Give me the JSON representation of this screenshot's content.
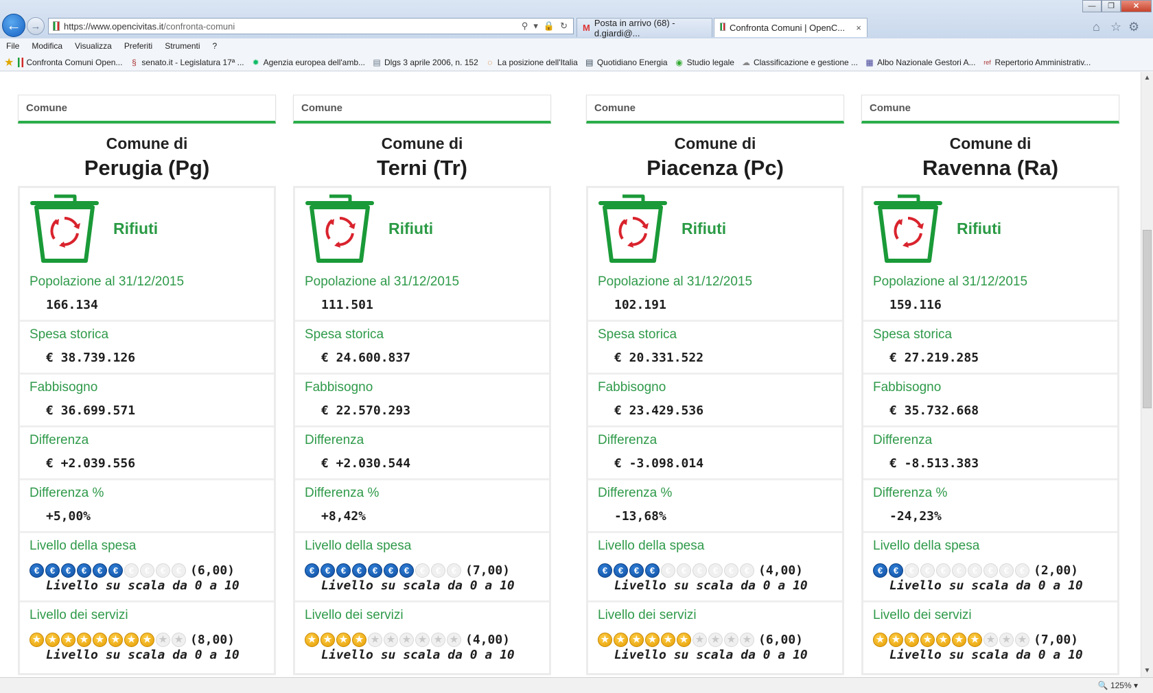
{
  "browser": {
    "url_host": "https://www.opencivitas.it",
    "url_path": "/confronta-comuni",
    "tabs": [
      {
        "label": "Posta in arrivo (68) - d.giardi@..."
      },
      {
        "label": "Confronta Comuni | OpenC...",
        "close": "×"
      }
    ],
    "menu": [
      "File",
      "Modifica",
      "Visualizza",
      "Preferiti",
      "Strumenti",
      "?"
    ],
    "favorites": [
      "Confronta Comuni  Open...",
      "senato.it - Legislatura 17ª ...",
      "Agenzia europea dell'amb...",
      "Dlgs 3 aprile 2006, n. 152",
      "La posizione dell'Italia",
      "Quotidiano Energia",
      "Studio legale",
      "Classificazione e gestione ...",
      "Albo Nazionale Gestori A...",
      "Repertorio Amministrativ..."
    ],
    "zoom": "125%"
  },
  "labels": {
    "header": "Comune",
    "comune_di": "Comune di",
    "sector": "Rifiuti",
    "popolazione": "Popolazione al 31/12/2015",
    "spesa_storica": "Spesa storica",
    "fabbisogno": "Fabbisogno",
    "differenza": "Differenza",
    "differenza_pct": "Differenza %",
    "livello_spesa": "Livello della spesa",
    "livello_servizi": "Livello dei servizi",
    "scala": "Livello su scala da 0 a 10"
  },
  "comuni": [
    {
      "name": "Perugia (Pg)",
      "popolazione": "166.134",
      "spesa_storica": "€ 38.739.126",
      "fabbisogno": "€ 36.699.571",
      "differenza": "€ +2.039.556",
      "differenza_pct": "+5,00%",
      "livello_spesa": 6,
      "livello_spesa_label": "(6,00)",
      "livello_servizi": 8,
      "livello_servizi_label": "(8,00)"
    },
    {
      "name": "Terni (Tr)",
      "popolazione": "111.501",
      "spesa_storica": "€ 24.600.837",
      "fabbisogno": "€ 22.570.293",
      "differenza": "€ +2.030.544",
      "differenza_pct": "+8,42%",
      "livello_spesa": 7,
      "livello_spesa_label": "(7,00)",
      "livello_servizi": 4,
      "livello_servizi_label": "(4,00)"
    },
    {
      "name": "Piacenza (Pc)",
      "popolazione": "102.191",
      "spesa_storica": "€ 20.331.522",
      "fabbisogno": "€ 23.429.536",
      "differenza": "€ -3.098.014",
      "differenza_pct": "-13,68%",
      "livello_spesa": 4,
      "livello_spesa_label": "(4,00)",
      "livello_servizi": 6,
      "livello_servizi_label": "(6,00)"
    },
    {
      "name": "Ravenna (Ra)",
      "popolazione": "159.116",
      "spesa_storica": "€ 27.219.285",
      "fabbisogno": "€ 35.732.668",
      "differenza": "€ -8.513.383",
      "differenza_pct": "-24,23%",
      "livello_spesa": 2,
      "livello_spesa_label": "(2,00)",
      "livello_servizi": 7,
      "livello_servizi_label": "(7,00)"
    }
  ],
  "colors": {
    "accent_green": "#2bad4a",
    "label_green": "#2f9a4a",
    "euro_blue": "#0f4e9f",
    "star_orange": "#e49c00",
    "recycle_red": "#d9232d"
  },
  "icons": {
    "euro": "€",
    "star": "★",
    "sector": "recycle-bin-icon"
  }
}
